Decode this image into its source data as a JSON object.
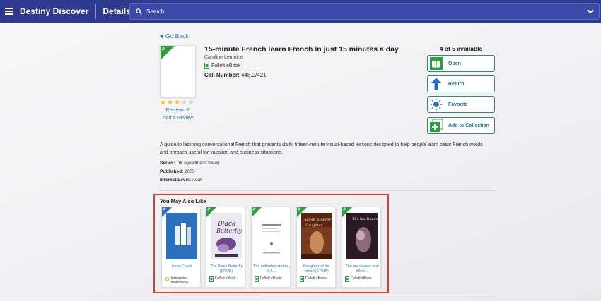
{
  "header": {
    "brand": "Destiny Discover",
    "page": "Details",
    "search_placeholder": "Search"
  },
  "nav": {
    "back_label": "Go Back"
  },
  "book": {
    "badge": "IN",
    "title": "15-minute French learn French in just 15 minutes a day",
    "author": "Caroline Lemoine",
    "format": "Follett eBook",
    "call_number_label": "Call Number:",
    "call_number": "448.2/421",
    "rating": 3,
    "rating_max": 5,
    "reviews": "Reviews: 6",
    "add_review": "Add a Review",
    "description": "A guide to learning conversational French that presents daily, fifteen-minute visual-based lessons designed to help people learn basic French words and phrases useful for vacation and business situations.",
    "series_label": "Series:",
    "series": "DK eyewitness travel",
    "published_label": "Published:",
    "published": "2005",
    "interest_label": "Interest Level:",
    "interest": "Adult"
  },
  "availability": "4 of 5 available",
  "actions": {
    "open": "Open",
    "return": "Return",
    "favorite": "Favorite",
    "add_to_collection": "Add to Collection"
  },
  "you_may_also_like": {
    "title": "You May Also Like",
    "items": [
      {
        "badge": "IN",
        "title": "Anne Frank",
        "format": "Interactive multimedia",
        "cover": "#2a6fbd"
      },
      {
        "badge": "IN",
        "title": "The Black Butterfly (EPUB)",
        "format": "Follett eBook",
        "cover": "#e8e4ef"
      },
      {
        "badge": "IN",
        "title": "The collected stories, R.A....",
        "format": "Follett eBook",
        "cover": "#ffffff"
      },
      {
        "badge": "IN",
        "title": "Daughter of the blood (EPUB)",
        "format": "Follett eBook",
        "cover": "#7a3a1e"
      },
      {
        "badge": "IN",
        "title": "The lau dancer and other...",
        "format": "Follett eBook",
        "cover": "#2a1a24"
      }
    ]
  },
  "colors": {
    "topbar": "#2e3a8f",
    "link": "#2a7ab8",
    "button_border": "#2e8a7c",
    "available_ribbon": "#2e9e3e",
    "highlight_box": "#e03b3b"
  }
}
